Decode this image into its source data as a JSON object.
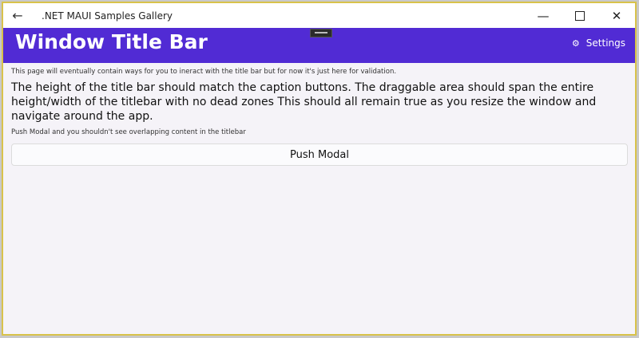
{
  "titlebar": {
    "app_title": ".NET MAUI Samples Gallery",
    "back_icon": "arrow-left-icon",
    "minimize_icon": "minimize-icon",
    "maximize_icon": "maximize-icon",
    "close_icon": "close-icon"
  },
  "header": {
    "title": "Window Title Bar",
    "settings_label": "Settings",
    "settings_icon": "gear-icon",
    "background": "#512bd4"
  },
  "content": {
    "intro_text": "This page will eventually contain ways for you to ineract with the title bar but for now it's just here for validation.",
    "main_text": "The height of the title bar should match the caption buttons. The draggable area should span the entire height/width of the titlebar with no dead zones  This should all remain true as you resize the window and navigate around the app.",
    "modal_hint": "Push Modal and you shouldn't see overlapping content in the titlebar",
    "push_modal_label": "Push Modal"
  }
}
